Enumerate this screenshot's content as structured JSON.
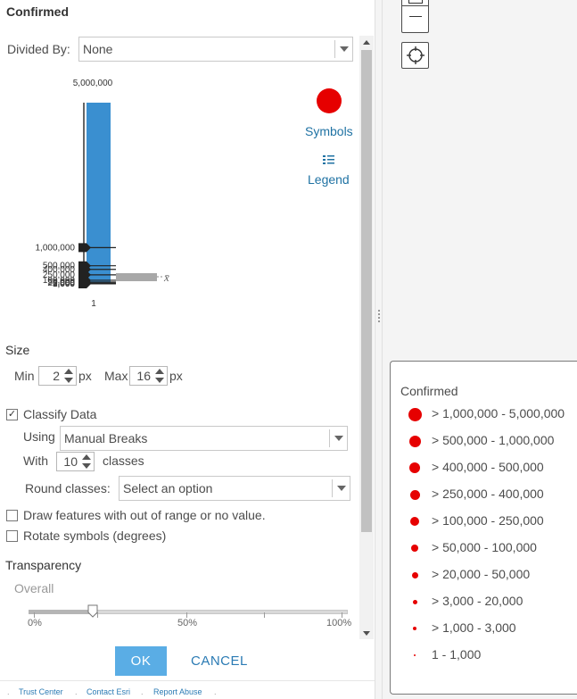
{
  "panel": {
    "title": "Confirmed"
  },
  "divided_by": {
    "label": "Divided By:",
    "value": "None"
  },
  "chart_data": {
    "type": "bar",
    "categories": [
      "1"
    ],
    "values": [
      5000000
    ],
    "ylim": [
      0,
      5000000
    ],
    "tick_labels": [
      "5,000,000",
      "1,000,000",
      "500,000",
      "400,000",
      "250,000",
      "100,000",
      "50,000",
      "20,000",
      "3,000",
      "1,000"
    ],
    "mean_label": "x̄"
  },
  "symbols_button": {
    "label": "Symbols",
    "color": "#e60000"
  },
  "legend_button": {
    "label": "Legend"
  },
  "size": {
    "title": "Size",
    "min_label": "Min",
    "min_value": "2",
    "min_unit": "px",
    "max_label": "Max",
    "max_value": "16",
    "max_unit": "px"
  },
  "classify": {
    "checkbox_label": "Classify Data",
    "checked": true,
    "using_label": "Using",
    "using_value": "Manual Breaks",
    "with_label": "With",
    "classes_value": "10",
    "classes_suffix": "classes",
    "round_label": "Round classes:",
    "round_placeholder": "Select an option"
  },
  "options": {
    "draw_out_of_range": "Draw features with out of range or no value.",
    "rotate_symbols": "Rotate symbols (degrees)"
  },
  "transparency": {
    "title": "Transparency",
    "overall_label": "Overall",
    "value_percent": 20,
    "tick_labels": [
      "0%",
      "50%",
      "100%"
    ]
  },
  "buttons": {
    "ok": "OK",
    "cancel": "CANCEL"
  },
  "footer": {
    "links": [
      "Trust Center",
      "Contact Esri",
      "Report Abuse"
    ]
  },
  "map_legend": {
    "title": "Confirmed",
    "items": [
      {
        "label": "> 1,000,000 - 5,000,000"
      },
      {
        "label": "> 500,000 - 1,000,000"
      },
      {
        "label": "> 400,000 - 500,000"
      },
      {
        "label": "> 250,000 - 400,000"
      },
      {
        "label": "> 100,000 - 250,000"
      },
      {
        "label": "> 50,000 - 100,000"
      },
      {
        "label": "> 20,000 - 50,000"
      },
      {
        "label": "> 3,000 - 20,000"
      },
      {
        "label": "> 1,000 - 3,000"
      },
      {
        "label": "1 - 1,000"
      }
    ],
    "symbol_color": "#e60000"
  },
  "icons": {
    "zoom_out": "minus-icon",
    "locate": "crosshair-icon",
    "legend": "list-icon",
    "handle": "slider-handle-icon"
  }
}
